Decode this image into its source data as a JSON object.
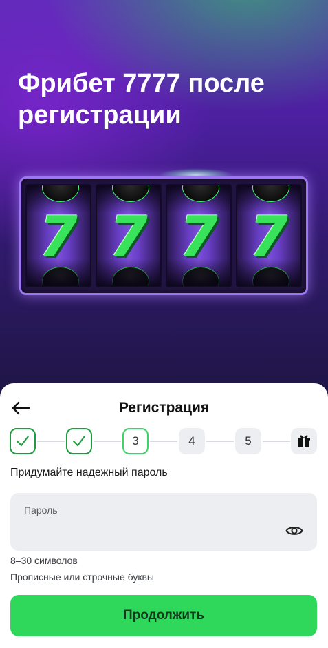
{
  "hero": {
    "title": "Фрибет 7777 после регистрации",
    "reels": [
      "7",
      "7",
      "7",
      "7"
    ]
  },
  "sheet": {
    "title": "Регистрация",
    "back_icon": "arrow-left-icon"
  },
  "stepper": {
    "steps": [
      {
        "label": "✓",
        "state": "done"
      },
      {
        "label": "✓",
        "state": "done"
      },
      {
        "label": "3",
        "state": "current"
      },
      {
        "label": "4",
        "state": "future"
      },
      {
        "label": "5",
        "state": "future"
      },
      {
        "label": "",
        "state": "future",
        "icon": "gift-icon"
      }
    ]
  },
  "form": {
    "prompt": "Придумайте надежный пароль",
    "password_placeholder": "Пароль",
    "password_value": "",
    "eye_icon": "eye-icon",
    "rules": [
      "8–30 символов",
      "Прописные или строчные буквы"
    ]
  },
  "actions": {
    "continue_label": "Продолжить"
  },
  "colors": {
    "accent_green": "#2fd85b",
    "step_done_border": "#1e9a3f",
    "hero_purple": "#5a2bb5"
  }
}
